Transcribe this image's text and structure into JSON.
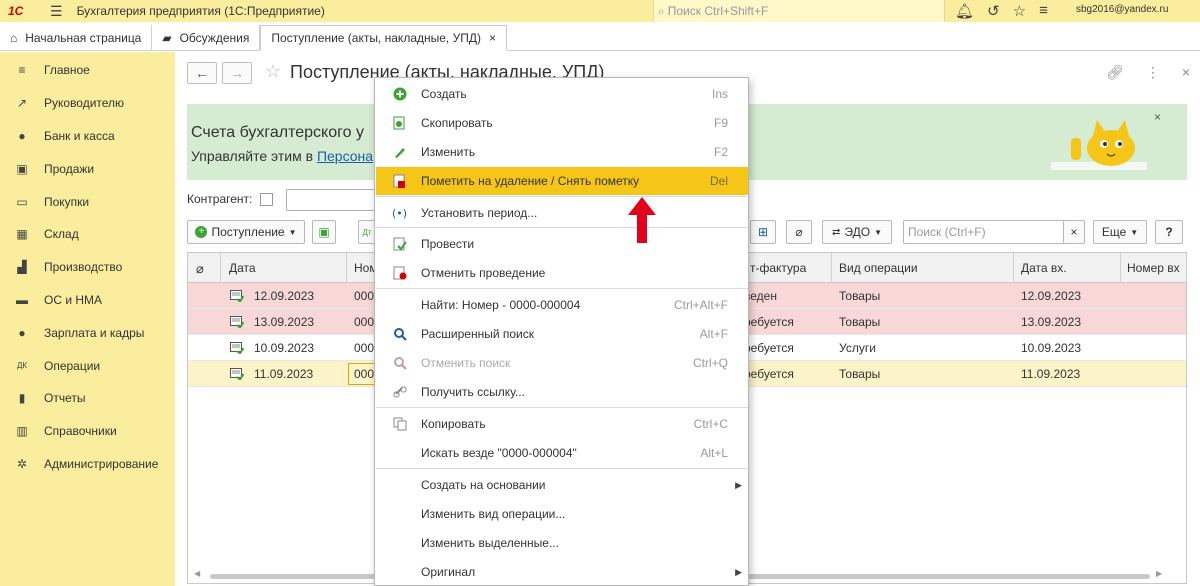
{
  "topbar": {
    "logo": "1С",
    "title": "Бухгалтерия предприятия  (1С:Предприятие)",
    "search_placeholder": "Поиск Ctrl+Shift+F",
    "user": "sbg2016@yandex.ru"
  },
  "tabs": [
    {
      "label": "Начальная страница"
    },
    {
      "label": "Обсуждения"
    },
    {
      "label": "Поступление (акты, накладные, УПД)"
    }
  ],
  "sidebar": {
    "items": [
      {
        "label": "Главное",
        "icon": "menu-lines-icon"
      },
      {
        "label": "Руководителю",
        "icon": "trend-icon"
      },
      {
        "label": "Банк и касса",
        "icon": "coin-icon"
      },
      {
        "label": "Продажи",
        "icon": "bag-icon"
      },
      {
        "label": "Покупки",
        "icon": "cart-icon"
      },
      {
        "label": "Склад",
        "icon": "warehouse-icon"
      },
      {
        "label": "Производство",
        "icon": "factory-icon"
      },
      {
        "label": "ОС и НМА",
        "icon": "truck-icon"
      },
      {
        "label": "Зарплата и кадры",
        "icon": "person-icon"
      },
      {
        "label": "Операции",
        "icon": "dt-kt-icon"
      },
      {
        "label": "Отчеты",
        "icon": "bar-chart-icon"
      },
      {
        "label": "Справочники",
        "icon": "books-icon"
      },
      {
        "label": "Администрирование",
        "icon": "gear-icon"
      }
    ]
  },
  "page": {
    "title": "Поступление (акты, накладные, УПД)"
  },
  "banner": {
    "line1": "Счета бухгалтерского у",
    "line2_prefix": "Управляйте этим в ",
    "link": "Персона"
  },
  "filter": {
    "label": "Контрагент:"
  },
  "toolbar": {
    "create": "Поступление",
    "edo": "ЭДО",
    "search_placeholder": "Поиск (Ctrl+F)",
    "clear": "×",
    "more": "Еще",
    "help": "?"
  },
  "table": {
    "columns": [
      "Дата",
      "Ном",
      "т-фактура",
      "Вид операции",
      "Дата вх.",
      "Номер вх"
    ],
    "rows": [
      {
        "date": "12.09.2023",
        "num": "000",
        "invoice": "веден",
        "op": "Товары",
        "indate": "12.09.2023",
        "bg": "#f8d7d7"
      },
      {
        "date": "13.09.2023",
        "num": "000",
        "invoice": "ребуется",
        "op": "Товары",
        "indate": "13.09.2023",
        "bg": "#f8d7d7"
      },
      {
        "date": "10.09.2023",
        "num": "000",
        "invoice": "ребуется",
        "op": "Услуги",
        "indate": "10.09.2023",
        "bg": "#ffffff"
      },
      {
        "date": "11.09.2023",
        "num": "000",
        "invoice": "ребуется",
        "op": "Товары",
        "indate": "11.09.2023",
        "bg": "#fdf3c8"
      }
    ]
  },
  "menu": {
    "items": [
      {
        "label": "Создать",
        "shortcut": "Ins",
        "icon": "plus-circle-icon"
      },
      {
        "label": "Скопировать",
        "shortcut": "F9",
        "icon": "copy-doc-icon"
      },
      {
        "label": "Изменить",
        "shortcut": "F2",
        "icon": "pencil-icon"
      },
      {
        "label": "Пометить на удаление / Снять пометку",
        "shortcut": "Del",
        "icon": "delete-mark-icon",
        "highlighted": true
      },
      {
        "label": "Установить период...",
        "shortcut": "",
        "icon": "period-icon"
      },
      {
        "label": "Провести",
        "shortcut": "",
        "icon": "post-icon"
      },
      {
        "label": "Отменить проведение",
        "shortcut": "",
        "icon": "unpost-icon"
      },
      {
        "label": "Найти: Номер - 0000-000004",
        "shortcut": "Ctrl+Alt+F",
        "icon": ""
      },
      {
        "label": "Расширенный поиск",
        "shortcut": "Alt+F",
        "icon": "search-icon"
      },
      {
        "label": "Отменить поиск",
        "shortcut": "Ctrl+Q",
        "icon": "cancel-search-icon",
        "disabled": true
      },
      {
        "label": "Получить ссылку...",
        "shortcut": "",
        "icon": "link-icon"
      },
      {
        "label": "Копировать",
        "shortcut": "Ctrl+C",
        "icon": "copy-icon"
      },
      {
        "label": "Искать везде \"0000-000004\"",
        "shortcut": "Alt+L",
        "icon": ""
      },
      {
        "label": "Создать на основании",
        "shortcut": "",
        "icon": "",
        "submenu": true
      },
      {
        "label": "Изменить вид операции...",
        "shortcut": "",
        "icon": ""
      },
      {
        "label": "Изменить выделенные...",
        "shortcut": "",
        "icon": ""
      },
      {
        "label": "Оригинал",
        "shortcut": "",
        "icon": "",
        "submenu": true
      }
    ]
  },
  "colors": {
    "accent": "#f5c518",
    "sidebar": "#fbed9e",
    "banner": "#d6ecd2",
    "arrow": "#e3001b"
  }
}
